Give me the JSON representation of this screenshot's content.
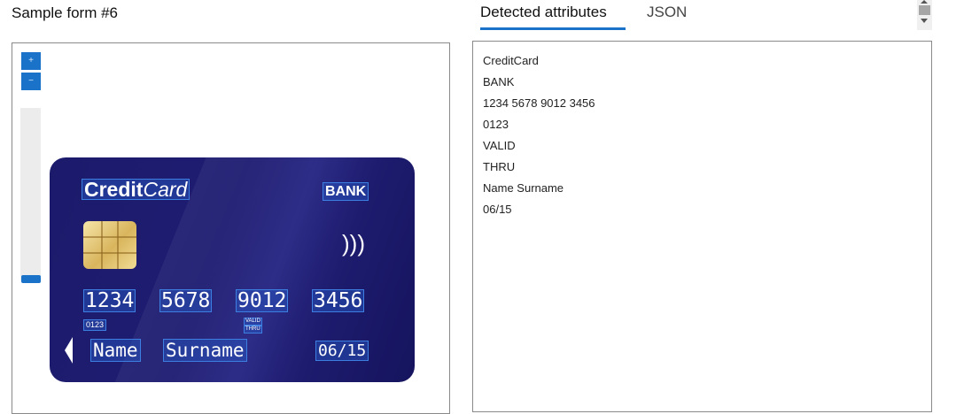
{
  "page_title": "Sample form #6",
  "tabs": [
    {
      "label": "Detected attributes"
    },
    {
      "label": "JSON"
    }
  ],
  "active_tab": "Detected attributes",
  "zoom": {
    "in_label": "+",
    "out_label": "−"
  },
  "card": {
    "brand_bold": "Credit",
    "brand_italic": "Card",
    "bank": "BANK",
    "number_groups": [
      "1234",
      "5678",
      "9012",
      "3456"
    ],
    "small_code": "0123",
    "valid_label": "VALID",
    "thru_label": "THRU",
    "name": "Name",
    "surname": "Surname",
    "expiry": "06/15",
    "contactless_symbol": ")))"
  },
  "attributes": [
    "CreditCard",
    "BANK",
    "1234 5678 9012 3456",
    "0123",
    "VALID",
    "THRU",
    "Name Surname",
    "06/15"
  ],
  "colors": {
    "accent": "#1a73c9",
    "card_background": "#1b1a6b",
    "highlight_border": "#3d7fe0"
  }
}
